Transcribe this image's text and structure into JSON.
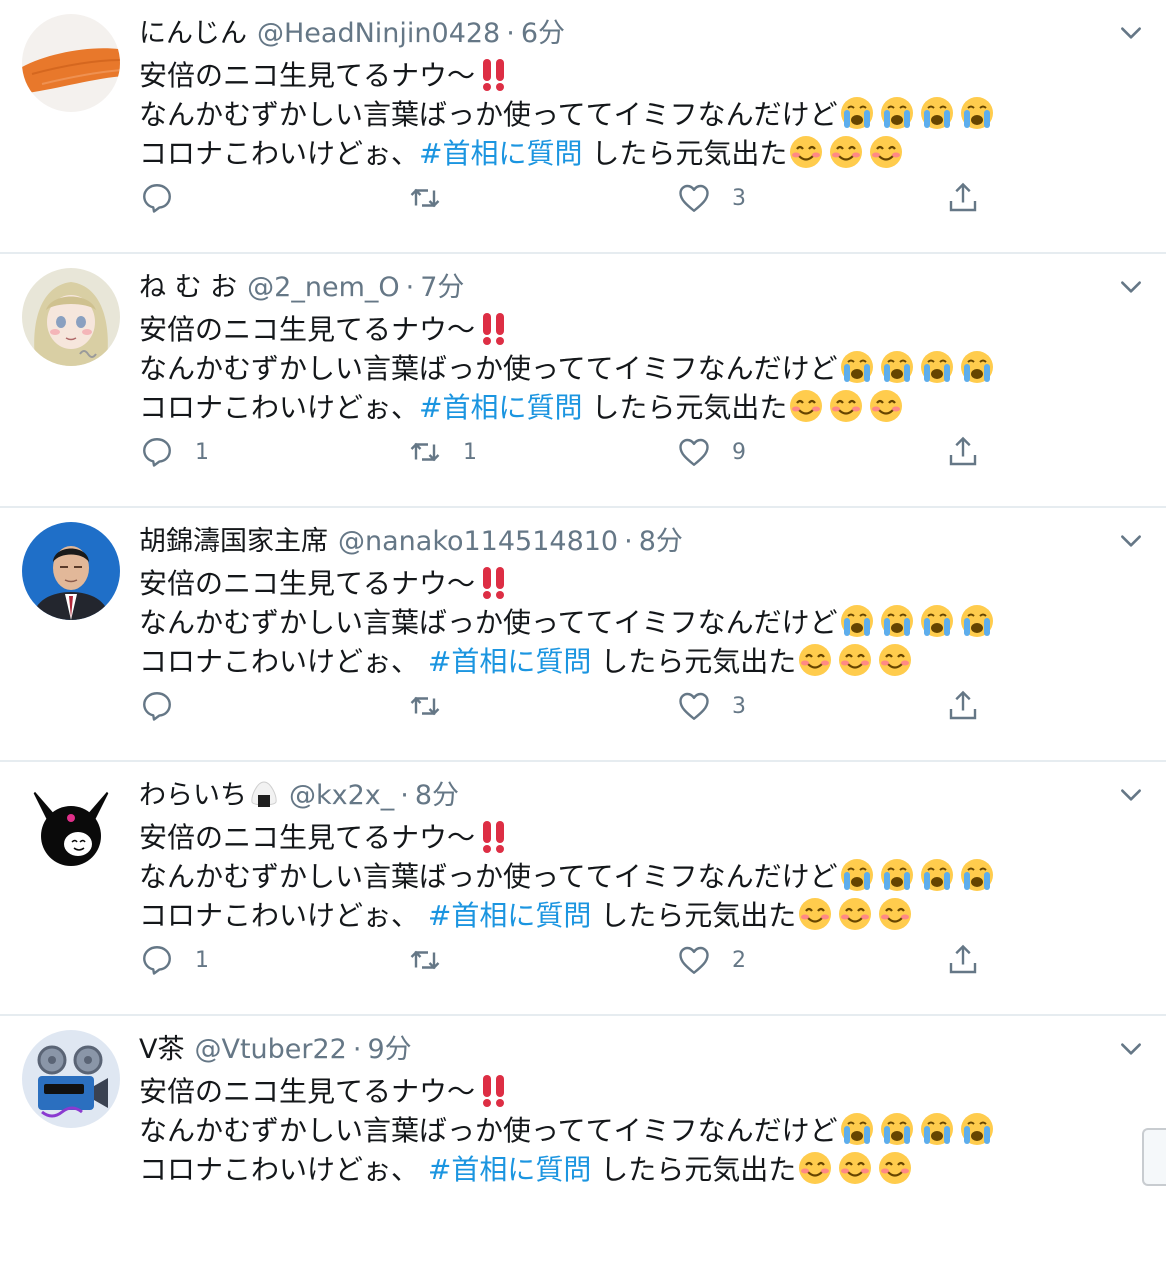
{
  "tweets": [
    {
      "display_name": "にんじん",
      "handle": "@HeadNinjin0428",
      "separator": "·",
      "time": "6分",
      "line1": "安倍のニコ生見てるナウ〜",
      "line2": "なんかむずかしい言葉ばっか使っててイミフなんだけど",
      "line3_prefix": "コロナこわいけどぉ、",
      "hashtag": "#首相に質問",
      "line3_suffix": "したら元気出た",
      "reply_count": "",
      "retweet_count": "",
      "like_count": "3",
      "avatar_icon": "carrot-avatar"
    },
    {
      "display_name": "ね む お",
      "handle": "@2_nem_O",
      "separator": "·",
      "time": "7分",
      "line1": "安倍のニコ生見てるナウ〜",
      "line2": "なんかむずかしい言葉ばっか使っててイミフなんだけど",
      "line3_prefix": "コロナこわいけどぉ、",
      "hashtag": "#首相に質問",
      "line3_suffix": "したら元気出た",
      "reply_count": "1",
      "retweet_count": "1",
      "like_count": "9",
      "avatar_icon": "anime-girl-avatar"
    },
    {
      "display_name": "胡錦濤国家主席",
      "handle": "@nanako114514810",
      "separator": "·",
      "time": "8分",
      "line1": "安倍のニコ生見てるナウ〜",
      "line2": "なんかむずかしい言葉ばっか使っててイミフなんだけど",
      "line3_prefix": "コロナこわいけどぉ、 ",
      "hashtag": "#首相に質問",
      "line3_suffix": "したら元気出た",
      "reply_count": "",
      "retweet_count": "",
      "like_count": "3",
      "avatar_icon": "portrait-avatar"
    },
    {
      "display_name": "わらいち",
      "handle": "@kx2x_",
      "separator": "·",
      "time": "8分",
      "line1": "安倍のニコ生見てるナウ〜",
      "line2": "なんかむずかしい言葉ばっか使っててイミフなんだけど",
      "line3_prefix": "コロナこわいけどぉ、 ",
      "hashtag": "#首相に質問",
      "line3_suffix": "したら元気出た",
      "reply_count": "1",
      "retweet_count": "",
      "like_count": "2",
      "avatar_icon": "bunny-avatar"
    },
    {
      "display_name": "V茶",
      "handle": "@Vtuber22",
      "separator": "·",
      "time": "9分",
      "line1": "安倍のニコ生見てるナウ〜",
      "line2": "なんかむずかしい言葉ばっか使っててイミフなんだけど",
      "line3_prefix": "コロナこわいけどぉ、 ",
      "hashtag": "#首相に質問",
      "line3_suffix": "したら元気出た",
      "reply_count": "",
      "retweet_count": "",
      "like_count": "",
      "avatar_icon": "film-camera-avatar"
    }
  ],
  "colors": {
    "accent": "#1b95e0",
    "secondary_text": "#657786",
    "divider": "#e6ecf0"
  }
}
